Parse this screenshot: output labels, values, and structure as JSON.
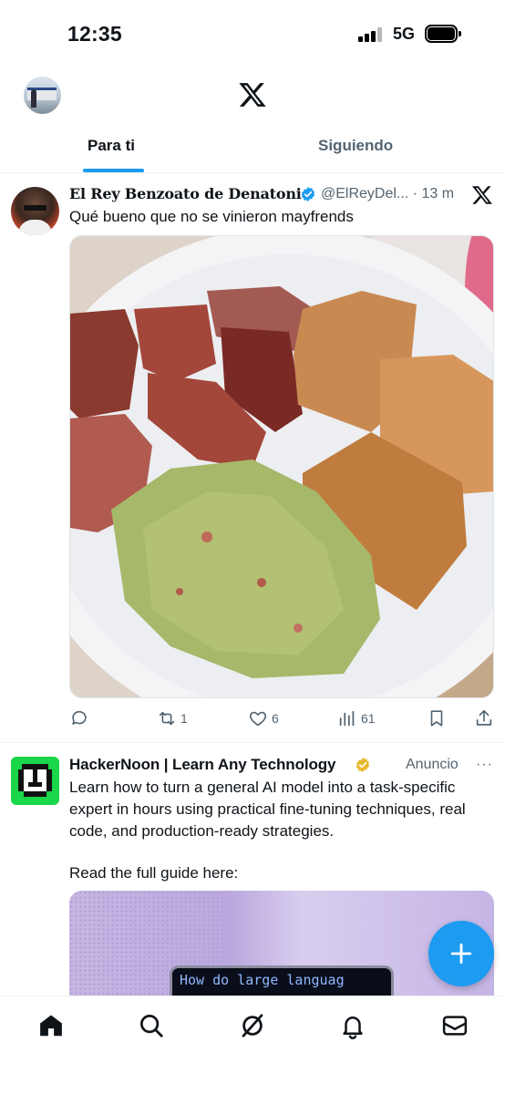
{
  "status_bar": {
    "time": "12:35",
    "network": "5G"
  },
  "tabs": [
    {
      "label": "Para ti",
      "active": true
    },
    {
      "label": "Siguiendo",
      "active": false
    }
  ],
  "accent_color": "#1d9bf0",
  "tweets": [
    {
      "author": "El Rey Benzoato de Denatonio",
      "handle_time": "@ElReyDel... · 13 m",
      "text": "Qué bueno que no se vinieron mayfrends",
      "actions": {
        "reply": "",
        "retweet": "1",
        "like": "6",
        "views": "61"
      }
    }
  ],
  "ad": {
    "author": "HackerNoon | Learn Any Technology",
    "label": "Anuncio",
    "more": "···",
    "text_line1": "Learn how to turn a general AI model into a task-specific expert in hours using practical fine-tuning techniques, real code, and production-ready strategies.",
    "text_line2": "Read the full guide here:",
    "card_text": "How do large languag"
  },
  "icons": {
    "nav": [
      "home-icon",
      "search-icon",
      "grok-icon",
      "notifications-icon",
      "messages-icon"
    ],
    "fab": "compose-plus-icon"
  }
}
